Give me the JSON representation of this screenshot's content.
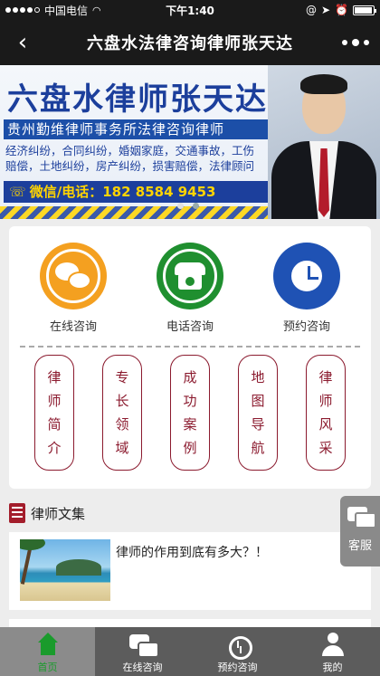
{
  "status_bar": {
    "carrier": "中国电信",
    "time": "下午1:40",
    "battery_label": "",
    "colors": {
      "background": "#1a1a1a"
    }
  },
  "nav": {
    "back_icon": "back-chevron-icon",
    "title": "六盘水法律咨询律师张天达",
    "more_icon": "more-dots-icon"
  },
  "banner": {
    "title": "六盘水律师张天达",
    "firm": "贵州勤维律师事务所法律咨询律师",
    "services_line1": "经济纠纷，合同纠纷，婚姻家庭，交通事故，工伤",
    "services_line2": "赔偿，土地纠纷，房产纠纷，损害赔偿，法律顾问",
    "contact": "微信/电话：182 8584 9453",
    "slide_count": 2,
    "active_slide": 1
  },
  "consult": [
    {
      "label": "在线咨询",
      "icon": "chat-bubbles-icon",
      "color": "#f4a020"
    },
    {
      "label": "电话咨询",
      "icon": "telephone-icon",
      "color": "#1f8f2f"
    },
    {
      "label": "预约咨询",
      "icon": "clock-icon",
      "color": "#1f52b4"
    }
  ],
  "categories": [
    {
      "chars": [
        "律",
        "师",
        "简",
        "介"
      ]
    },
    {
      "chars": [
        "专",
        "长",
        "领",
        "域"
      ]
    },
    {
      "chars": [
        "成",
        "功",
        "案",
        "例"
      ]
    },
    {
      "chars": [
        "地",
        "图",
        "导",
        "航"
      ]
    },
    {
      "chars": [
        "律",
        "师",
        "风",
        "采"
      ]
    }
  ],
  "service_float": {
    "label": "客服",
    "icon": "customer-service-icon"
  },
  "articles_section": {
    "title": "律师文集",
    "icon": "book-icon",
    "items": [
      {
        "title": "律师的作用到底有多大？！"
      }
    ]
  },
  "tabbar": [
    {
      "label": "首页",
      "icon": "home-icon",
      "active": true
    },
    {
      "label": "在线咨询",
      "icon": "chat-icon",
      "active": false
    },
    {
      "label": "预约咨询",
      "icon": "alarm-clock-icon",
      "active": false
    },
    {
      "label": "我的",
      "icon": "user-icon",
      "active": false
    }
  ],
  "colors": {
    "accent_blue": "#1c3f9c",
    "category_red": "#8b1a2e",
    "tab_active_green": "#1a9b2c"
  }
}
